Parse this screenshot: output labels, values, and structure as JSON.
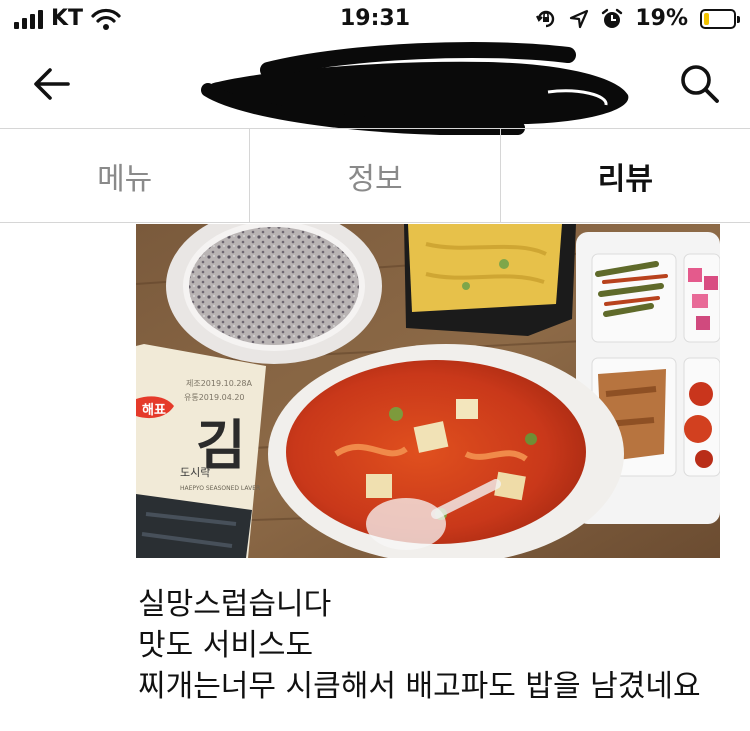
{
  "status_bar": {
    "carrier": "KT",
    "time": "19:31",
    "battery_percent": "19%",
    "battery_level": 0.19,
    "battery_color": "#f2c300",
    "icons": [
      "signal-icon",
      "wifi-icon",
      "orientation-lock-icon",
      "location-icon",
      "alarm-icon",
      "battery-icon"
    ]
  },
  "nav": {
    "back_icon": "arrow-left-icon",
    "search_icon": "search-icon"
  },
  "tabs": [
    {
      "label": "메뉴",
      "active": false
    },
    {
      "label": "정보",
      "active": false
    },
    {
      "label": "리뷰",
      "active": true
    }
  ],
  "review": {
    "photo_labels": {
      "seaweed_brand": "해표",
      "seaweed_name": "김",
      "seaweed_sub": "도시락",
      "seaweed_eng": "HAEPYO SEASONED LAVER",
      "seaweed_date1": "제조2019.10.28A",
      "seaweed_date2": "유통2019.04.20"
    },
    "lines": [
      "실망스럽습니다",
      "맛도 서비스도",
      "찌개는너무 시큼해서 배고파도 밥을 남겼네요"
    ]
  }
}
